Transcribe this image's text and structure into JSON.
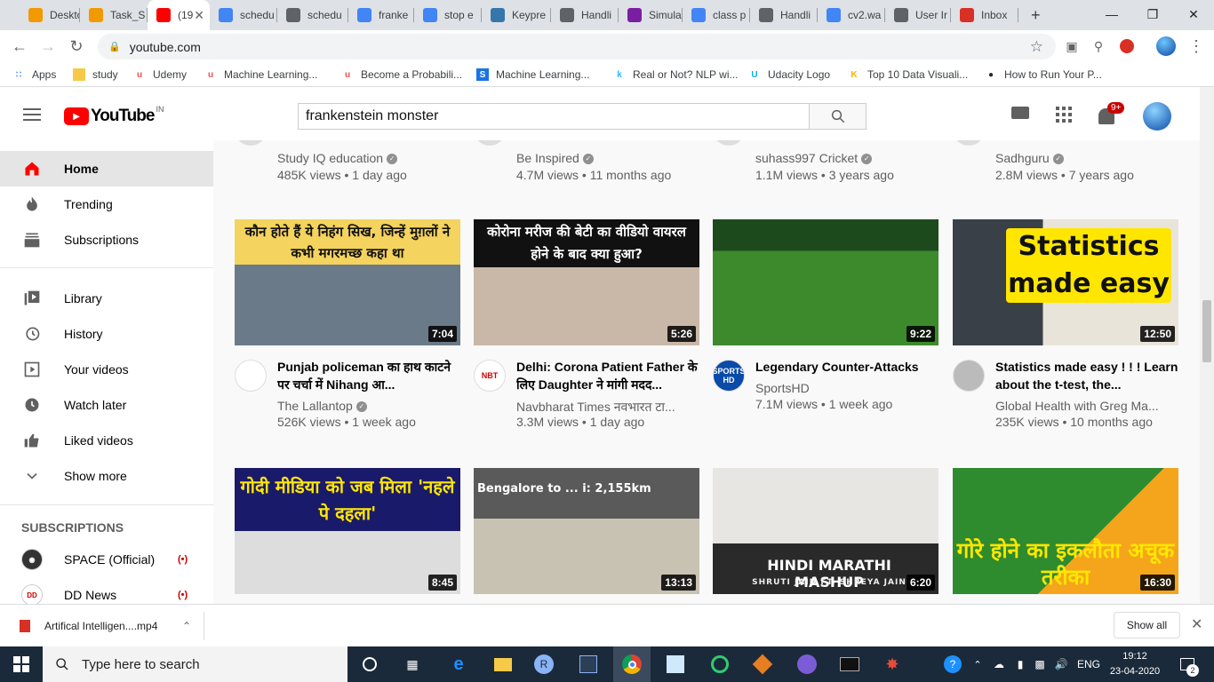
{
  "browser": {
    "tabs": [
      {
        "label": "Deskto",
        "color": "#f29900",
        "icon": "doc-icon"
      },
      {
        "label": "Task_S",
        "color": "#f29900",
        "icon": "doc-icon"
      },
      {
        "label": "(19",
        "color": "#ff0000",
        "icon": "youtube-icon",
        "active": true
      },
      {
        "label": "schedu",
        "color": "#4285f4",
        "icon": "google-icon"
      },
      {
        "label": "schedu",
        "color": "#5f6368",
        "icon": "page-icon"
      },
      {
        "label": "franke",
        "color": "#4285f4",
        "icon": "google-icon"
      },
      {
        "label": "stop e",
        "color": "#4285f4",
        "icon": "google-icon"
      },
      {
        "label": "Keypre",
        "color": "#3776ab",
        "icon": "python-icon"
      },
      {
        "label": "Handli",
        "color": "#5f6368",
        "icon": "globe-icon"
      },
      {
        "label": "Simula",
        "color": "#7b1fa2",
        "icon": "ne-icon"
      },
      {
        "label": "class p",
        "color": "#4285f4",
        "icon": "google-icon"
      },
      {
        "label": "Handli",
        "color": "#5f6368",
        "icon": "page-icon"
      },
      {
        "label": "cv2.wa",
        "color": "#4285f4",
        "icon": "google-icon"
      },
      {
        "label": "User Ir",
        "color": "#5f6368",
        "icon": "globe-icon"
      },
      {
        "label": "Inbox",
        "color": "#d93025",
        "icon": "gmail-icon"
      }
    ],
    "url": "youtube.com",
    "bookmarks": [
      {
        "label": "Apps",
        "icon": "apps-icon"
      },
      {
        "label": "study",
        "icon": "folder-icon"
      },
      {
        "label": "Udemy",
        "icon": "udemy-icon"
      },
      {
        "label": "Machine Learning...",
        "icon": "udemy-icon"
      },
      {
        "label": "Become a Probabili...",
        "icon": "udemy-icon"
      },
      {
        "label": "Machine Learning...",
        "icon": "s-icon"
      },
      {
        "label": "Real or Not? NLP wi...",
        "icon": "kaggle-icon"
      },
      {
        "label": "Udacity Logo",
        "icon": "udacity-icon"
      },
      {
        "label": "Top 10 Data Visuali...",
        "icon": "k-icon"
      },
      {
        "label": "How to Run Your P...",
        "icon": "github-icon"
      }
    ]
  },
  "youtube": {
    "logo_text": "YouTube",
    "region": "IN",
    "search_value": "frankenstein monster",
    "notification_count": "9+",
    "sidebar": {
      "main": [
        {
          "label": "Home",
          "icon": "home-icon",
          "active": true
        },
        {
          "label": "Trending",
          "icon": "fire-icon"
        },
        {
          "label": "Subscriptions",
          "icon": "subscriptions-icon"
        }
      ],
      "library": [
        {
          "label": "Library",
          "icon": "library-icon"
        },
        {
          "label": "History",
          "icon": "history-icon"
        },
        {
          "label": "Your videos",
          "icon": "play-square-icon"
        },
        {
          "label": "Watch later",
          "icon": "clock-icon"
        },
        {
          "label": "Liked videos",
          "icon": "thumbs-up-icon"
        },
        {
          "label": "Show more",
          "icon": "chevron-down-icon"
        }
      ],
      "subscriptions_heading": "SUBSCRIPTIONS",
      "subscriptions": [
        {
          "label": "SPACE (Official)",
          "live": true
        },
        {
          "label": "DD News",
          "live": true
        }
      ]
    },
    "partial_row": [
      {
        "channel": "Study IQ education",
        "meta": "485K views • 1 day ago",
        "verified": true
      },
      {
        "channel": "Be Inspired",
        "meta": "4.7M views • 11 months ago",
        "verified": true
      },
      {
        "channel": "suhass997 Cricket",
        "meta": "1.1M views • 3 years ago",
        "verified": true
      },
      {
        "channel": "Sadhguru",
        "meta": "2.8M views • 7 years ago",
        "verified": true
      }
    ],
    "videos": [
      {
        "title": "Punjab policeman का हाथ काटने पर चर्चा में Nihang आ...",
        "channel": "The Lallantop",
        "verified": true,
        "meta": "526K views • 1 week ago",
        "duration": "7:04",
        "thumb_text": "कौन होते हैं ये निहंग सिख, जिन्हें मुग़लों ने कभी मगरमच्छ कहा था"
      },
      {
        "title": "Delhi: Corona Patient Father के लिए Daughter ने मांगी मदद...",
        "channel": "Navbharat Times नवभारत टा...",
        "verified": false,
        "meta": "3.3M views • 1 day ago",
        "duration": "5:26",
        "thumb_text": "कोरोना मरीज की बेटी का वीडियो वायरल होने के बाद क्या हुआ?",
        "avatar_text": "NBT"
      },
      {
        "title": "Legendary Counter-Attacks",
        "channel": "SportsHD",
        "verified": false,
        "meta": "7.1M views • 1 week ago",
        "duration": "9:22",
        "thumb_text": "",
        "avatar_text": "SPORTS HD"
      },
      {
        "title": "Statistics made easy ! ! ! Learn about the t-test, the...",
        "channel": "Global Health with Greg Ma...",
        "verified": false,
        "meta": "235K views • 10 months ago",
        "duration": "12:50",
        "thumb_text": "Statistics made easy"
      },
      {
        "title": "",
        "channel": "",
        "meta": "",
        "duration": "8:45",
        "thumb_text": "गोदी मीडिया को जब मिला 'नहले पे दहला'"
      },
      {
        "title": "",
        "channel": "",
        "meta": "",
        "duration": "13:13",
        "thumb_text": "Bengalore to ... i: 2,155km"
      },
      {
        "title": "",
        "channel": "",
        "meta": "",
        "duration": "6:20",
        "thumb_text": "HINDI MARATHI MASHUP",
        "thumb_sub": "SHRUTI JAIN FT. SHREYA JAIN"
      },
      {
        "title": "",
        "channel": "",
        "meta": "",
        "duration": "16:30",
        "thumb_text": "गोरे होने का इकलौता अचूक तरीका"
      }
    ]
  },
  "download": {
    "filename": "Artifical Intelligen....mp4",
    "show_all": "Show all"
  },
  "taskbar": {
    "search_placeholder": "Type here to search",
    "language": "ENG",
    "time": "19:12",
    "date": "23-04-2020",
    "notifications": "2"
  }
}
